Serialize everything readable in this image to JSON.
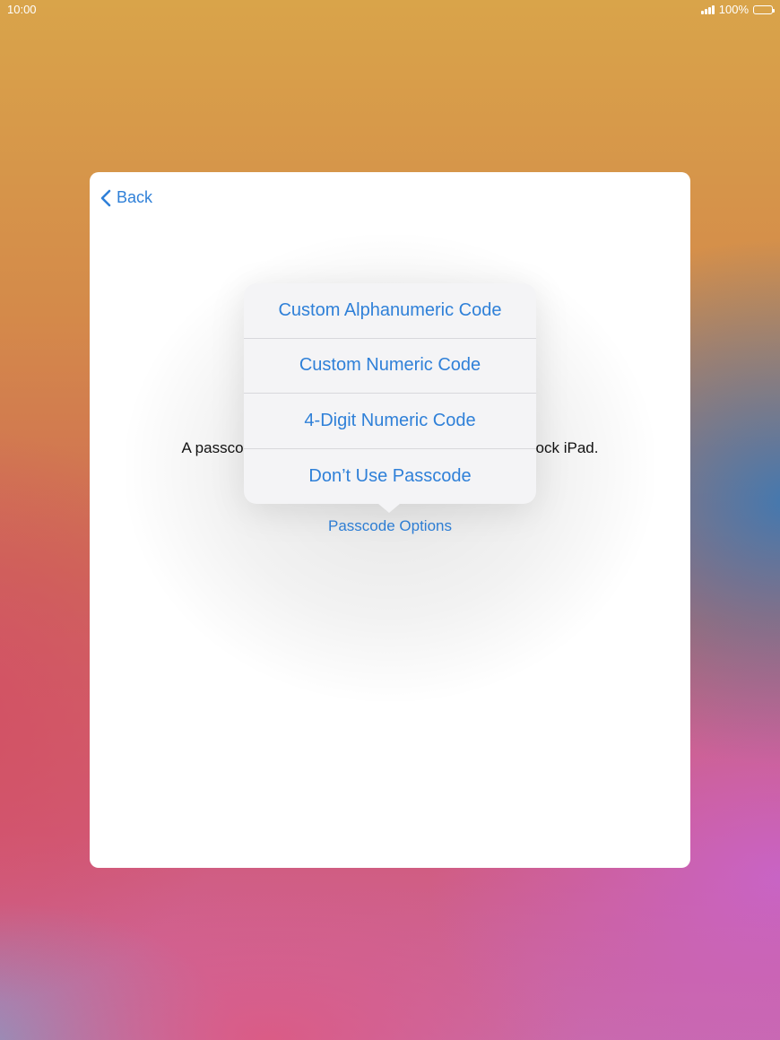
{
  "status_bar": {
    "time": "10:00",
    "battery_percent": "100%"
  },
  "sheet": {
    "back_label": "Back",
    "description_left": "A passco",
    "description_right": "ock iPad.",
    "passcode_options_label": "Passcode Options"
  },
  "popover": {
    "items": [
      {
        "label": "Custom Alphanumeric Code"
      },
      {
        "label": "Custom Numeric Code"
      },
      {
        "label": "4-Digit Numeric Code"
      },
      {
        "label": "Don’t Use Passcode"
      }
    ]
  },
  "colors": {
    "accent": "#2f80d8",
    "sheet_bg": "#ffffff",
    "popover_bg": "#f4f4f6"
  },
  "icons": {
    "back": "chevron-left-icon",
    "signal": "cellular-signal-icon",
    "battery": "battery-icon"
  }
}
